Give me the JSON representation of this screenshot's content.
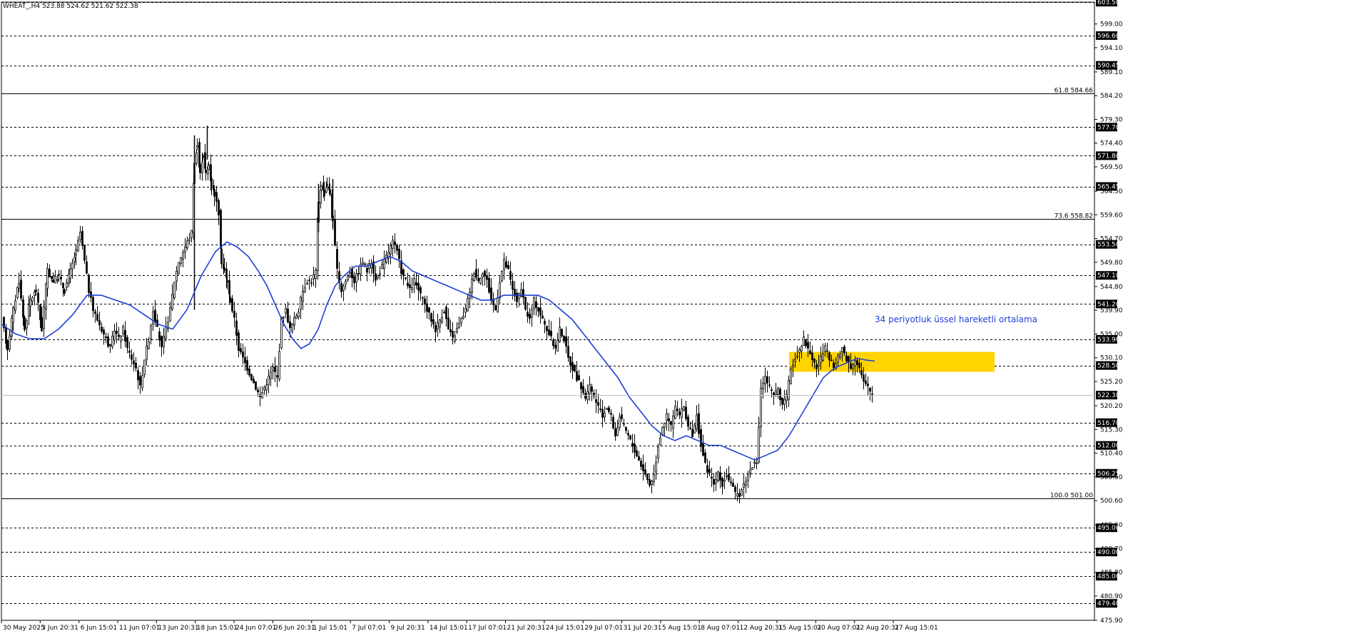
{
  "header": {
    "symbol": "WHEAT_,H4  523.88 524.62 521.62 522.38"
  },
  "chart_data": {
    "type": "candlestick",
    "symbol": "WHEAT_",
    "timeframe": "H4",
    "ylim": [
      475.9,
      603.5
    ],
    "y_ticks": [
      599.0,
      594.1,
      589.1,
      584.2,
      579.3,
      574.4,
      569.5,
      564.5,
      559.6,
      554.7,
      549.8,
      544.8,
      539.9,
      535.0,
      530.1,
      525.2,
      520.2,
      515.3,
      510.4,
      505.5,
      500.6,
      495.6,
      490.7,
      485.8,
      480.9,
      475.9
    ],
    "horizontal_levels": [
      603.5,
      596.6,
      590.45,
      577.7,
      571.8,
      565.45,
      553.5,
      547.1,
      541.2,
      533.9,
      528.5,
      516.7,
      512.0,
      506.25,
      495.0,
      490.0,
      485.0,
      479.4
    ],
    "current_price": 522.38,
    "fibonacci_levels": [
      {
        "label": "61.8 584.66",
        "price": 584.66
      },
      {
        "label": "73.6 558.82",
        "price": 558.82
      },
      {
        "label": "100.0 501.00",
        "price": 501.0
      }
    ],
    "x_tick_labels": [
      "30 May 2025",
      "3 Jun 20:31",
      "6 Jun 15:01",
      "11 Jun 07:01",
      "13 Jun 20:31",
      "18 Jun 15:01",
      "24 Jun 07:01",
      "26 Jun 20:31",
      "1 Jul 15:01",
      "7 Jul 07:01",
      "9 Jul 20:31",
      "14 Jul 15:01",
      "17 Jul 07:01",
      "21 Jul 20:31",
      "24 Jul 15:01",
      "29 Jul 07:01",
      "31 Jul 20:31",
      "5 Aug 15:01",
      "8 Aug 07:01",
      "12 Aug 20:31",
      "15 Aug 15:01",
      "20 Aug 07:01",
      "22 Aug 20:31",
      "27 Aug 15:01"
    ],
    "annotation": {
      "text": "34 periyotluk üssel hareketli ortalama",
      "color": "#1f3fd6"
    },
    "zone": {
      "price_low": 527.2,
      "price_high": 531.3,
      "color": "#ffd400"
    },
    "ema_color": "#1f3fd6",
    "candle_color": "#000000",
    "price_path": [
      [
        0,
        538
      ],
      [
        8,
        532
      ],
      [
        16,
        540
      ],
      [
        24,
        546
      ],
      [
        32,
        536
      ],
      [
        40,
        542
      ],
      [
        48,
        544
      ],
      [
        56,
        536
      ],
      [
        64,
        548
      ],
      [
        72,
        546
      ],
      [
        80,
        547
      ],
      [
        88,
        544
      ],
      [
        96,
        548
      ],
      [
        104,
        552
      ],
      [
        110,
        556
      ],
      [
        116,
        550
      ],
      [
        122,
        544
      ],
      [
        128,
        540
      ],
      [
        134,
        538
      ],
      [
        140,
        536
      ],
      [
        146,
        534
      ],
      [
        152,
        532
      ],
      [
        158,
        536
      ],
      [
        164,
        534
      ],
      [
        170,
        536
      ],
      [
        176,
        532
      ],
      [
        182,
        530
      ],
      [
        188,
        528
      ],
      [
        194,
        524
      ],
      [
        200,
        530
      ],
      [
        206,
        534
      ],
      [
        212,
        540
      ],
      [
        218,
        536
      ],
      [
        224,
        532
      ],
      [
        230,
        536
      ],
      [
        236,
        540
      ],
      [
        242,
        546
      ],
      [
        248,
        550
      ],
      [
        254,
        552
      ],
      [
        260,
        554
      ],
      [
        266,
        556
      ],
      [
        270,
        570
      ],
      [
        274,
        574
      ],
      [
        278,
        568
      ],
      [
        282,
        572
      ],
      [
        286,
        568
      ],
      [
        290,
        570
      ],
      [
        294,
        566
      ],
      [
        298,
        564
      ],
      [
        304,
        560
      ],
      [
        308,
        550
      ],
      [
        312,
        548
      ],
      [
        316,
        546
      ],
      [
        320,
        542
      ],
      [
        326,
        538
      ],
      [
        332,
        532
      ],
      [
        338,
        530
      ],
      [
        344,
        528
      ],
      [
        350,
        526
      ],
      [
        356,
        524
      ],
      [
        362,
        522
      ],
      [
        368,
        524
      ],
      [
        374,
        526
      ],
      [
        380,
        528
      ],
      [
        386,
        526
      ],
      [
        392,
        538
      ],
      [
        398,
        540
      ],
      [
        404,
        536
      ],
      [
        410,
        538
      ],
      [
        416,
        540
      ],
      [
        422,
        544
      ],
      [
        428,
        546
      ],
      [
        434,
        546
      ],
      [
        440,
        548
      ],
      [
        444,
        562
      ],
      [
        448,
        566
      ],
      [
        452,
        564
      ],
      [
        456,
        566
      ],
      [
        460,
        564
      ],
      [
        464,
        558
      ],
      [
        470,
        548
      ],
      [
        476,
        544
      ],
      [
        482,
        546
      ],
      [
        488,
        548
      ],
      [
        494,
        546
      ],
      [
        500,
        548
      ],
      [
        506,
        550
      ],
      [
        512,
        548
      ],
      [
        518,
        550
      ],
      [
        524,
        546
      ],
      [
        530,
        548
      ],
      [
        536,
        550
      ],
      [
        542,
        552
      ],
      [
        548,
        554
      ],
      [
        554,
        552
      ],
      [
        560,
        548
      ],
      [
        566,
        546
      ],
      [
        572,
        544
      ],
      [
        578,
        546
      ],
      [
        584,
        544
      ],
      [
        590,
        542
      ],
      [
        596,
        540
      ],
      [
        602,
        538
      ],
      [
        608,
        536
      ],
      [
        614,
        538
      ],
      [
        620,
        540
      ],
      [
        626,
        536
      ],
      [
        632,
        534
      ],
      [
        638,
        536
      ],
      [
        644,
        538
      ],
      [
        650,
        540
      ],
      [
        656,
        544
      ],
      [
        662,
        548
      ],
      [
        668,
        546
      ],
      [
        674,
        548
      ],
      [
        680,
        546
      ],
      [
        686,
        542
      ],
      [
        692,
        540
      ],
      [
        698,
        546
      ],
      [
        704,
        550
      ],
      [
        710,
        548
      ],
      [
        716,
        544
      ],
      [
        722,
        542
      ],
      [
        728,
        544
      ],
      [
        734,
        540
      ],
      [
        740,
        538
      ],
      [
        746,
        542
      ],
      [
        752,
        540
      ],
      [
        758,
        538
      ],
      [
        764,
        536
      ],
      [
        770,
        534
      ],
      [
        776,
        532
      ],
      [
        782,
        536
      ],
      [
        788,
        534
      ],
      [
        794,
        530
      ],
      [
        800,
        528
      ],
      [
        806,
        526
      ],
      [
        812,
        524
      ],
      [
        818,
        522
      ],
      [
        824,
        524
      ],
      [
        830,
        522
      ],
      [
        836,
        520
      ],
      [
        842,
        518
      ],
      [
        848,
        520
      ],
      [
        854,
        518
      ],
      [
        860,
        514
      ],
      [
        866,
        518
      ],
      [
        872,
        516
      ],
      [
        878,
        514
      ],
      [
        884,
        512
      ],
      [
        890,
        510
      ],
      [
        896,
        508
      ],
      [
        902,
        506
      ],
      [
        908,
        504
      ],
      [
        914,
        506
      ],
      [
        920,
        512
      ],
      [
        926,
        516
      ],
      [
        932,
        518
      ],
      [
        938,
        516
      ],
      [
        944,
        520
      ],
      [
        950,
        518
      ],
      [
        956,
        520
      ],
      [
        962,
        516
      ],
      [
        968,
        514
      ],
      [
        974,
        518
      ],
      [
        980,
        512
      ],
      [
        986,
        508
      ],
      [
        992,
        506
      ],
      [
        998,
        504
      ],
      [
        1004,
        506
      ],
      [
        1010,
        504
      ],
      [
        1016,
        506
      ],
      [
        1022,
        504
      ],
      [
        1028,
        502
      ],
      [
        1034,
        502
      ],
      [
        1040,
        504
      ],
      [
        1046,
        506
      ],
      [
        1052,
        508
      ],
      [
        1058,
        508
      ],
      [
        1064,
        524
      ],
      [
        1070,
        526
      ],
      [
        1076,
        524
      ],
      [
        1082,
        522
      ],
      [
        1088,
        524
      ],
      [
        1094,
        520
      ],
      [
        1100,
        522
      ],
      [
        1106,
        528
      ],
      [
        1112,
        530
      ],
      [
        1118,
        532
      ],
      [
        1124,
        534
      ],
      [
        1130,
        532
      ],
      [
        1136,
        530
      ],
      [
        1142,
        528
      ],
      [
        1148,
        530
      ],
      [
        1154,
        532
      ],
      [
        1160,
        530
      ],
      [
        1166,
        528
      ],
      [
        1172,
        530
      ],
      [
        1178,
        532
      ],
      [
        1184,
        530
      ],
      [
        1190,
        528
      ],
      [
        1196,
        530
      ],
      [
        1202,
        528
      ],
      [
        1208,
        525
      ],
      [
        1214,
        524
      ],
      [
        1220,
        522.4
      ]
    ],
    "ema_path": [
      [
        0,
        537
      ],
      [
        20,
        535
      ],
      [
        40,
        534
      ],
      [
        60,
        534
      ],
      [
        80,
        536
      ],
      [
        100,
        539
      ],
      [
        120,
        543
      ],
      [
        140,
        543
      ],
      [
        160,
        542
      ],
      [
        180,
        541
      ],
      [
        200,
        539
      ],
      [
        220,
        537
      ],
      [
        240,
        536
      ],
      [
        260,
        540
      ],
      [
        280,
        547
      ],
      [
        300,
        552
      ],
      [
        316,
        554
      ],
      [
        330,
        553
      ],
      [
        346,
        551
      ],
      [
        360,
        548
      ],
      [
        372,
        545
      ],
      [
        384,
        541
      ],
      [
        396,
        537
      ],
      [
        408,
        534
      ],
      [
        420,
        532
      ],
      [
        432,
        533
      ],
      [
        444,
        536
      ],
      [
        456,
        541
      ],
      [
        468,
        545
      ],
      [
        480,
        547
      ],
      [
        496,
        549
      ],
      [
        512,
        549
      ],
      [
        528,
        550
      ],
      [
        544,
        551
      ],
      [
        560,
        550
      ],
      [
        576,
        548
      ],
      [
        592,
        547
      ],
      [
        608,
        546
      ],
      [
        624,
        545
      ],
      [
        640,
        544
      ],
      [
        656,
        543
      ],
      [
        672,
        542
      ],
      [
        688,
        542
      ],
      [
        704,
        543
      ],
      [
        720,
        543
      ],
      [
        736,
        543
      ],
      [
        752,
        543
      ],
      [
        768,
        542
      ],
      [
        784,
        540
      ],
      [
        800,
        538
      ],
      [
        816,
        535
      ],
      [
        832,
        532
      ],
      [
        848,
        529
      ],
      [
        864,
        526
      ],
      [
        880,
        522
      ],
      [
        896,
        519
      ],
      [
        912,
        516
      ],
      [
        928,
        514
      ],
      [
        944,
        513
      ],
      [
        960,
        514
      ],
      [
        976,
        513
      ],
      [
        992,
        512
      ],
      [
        1008,
        512
      ],
      [
        1024,
        511
      ],
      [
        1040,
        510
      ],
      [
        1056,
        509
      ],
      [
        1072,
        510
      ],
      [
        1088,
        511
      ],
      [
        1104,
        514
      ],
      [
        1120,
        518
      ],
      [
        1136,
        522
      ],
      [
        1152,
        526
      ],
      [
        1168,
        528
      ],
      [
        1184,
        529
      ],
      [
        1200,
        530
      ],
      [
        1212,
        529.6
      ],
      [
        1224,
        529.4
      ]
    ]
  }
}
